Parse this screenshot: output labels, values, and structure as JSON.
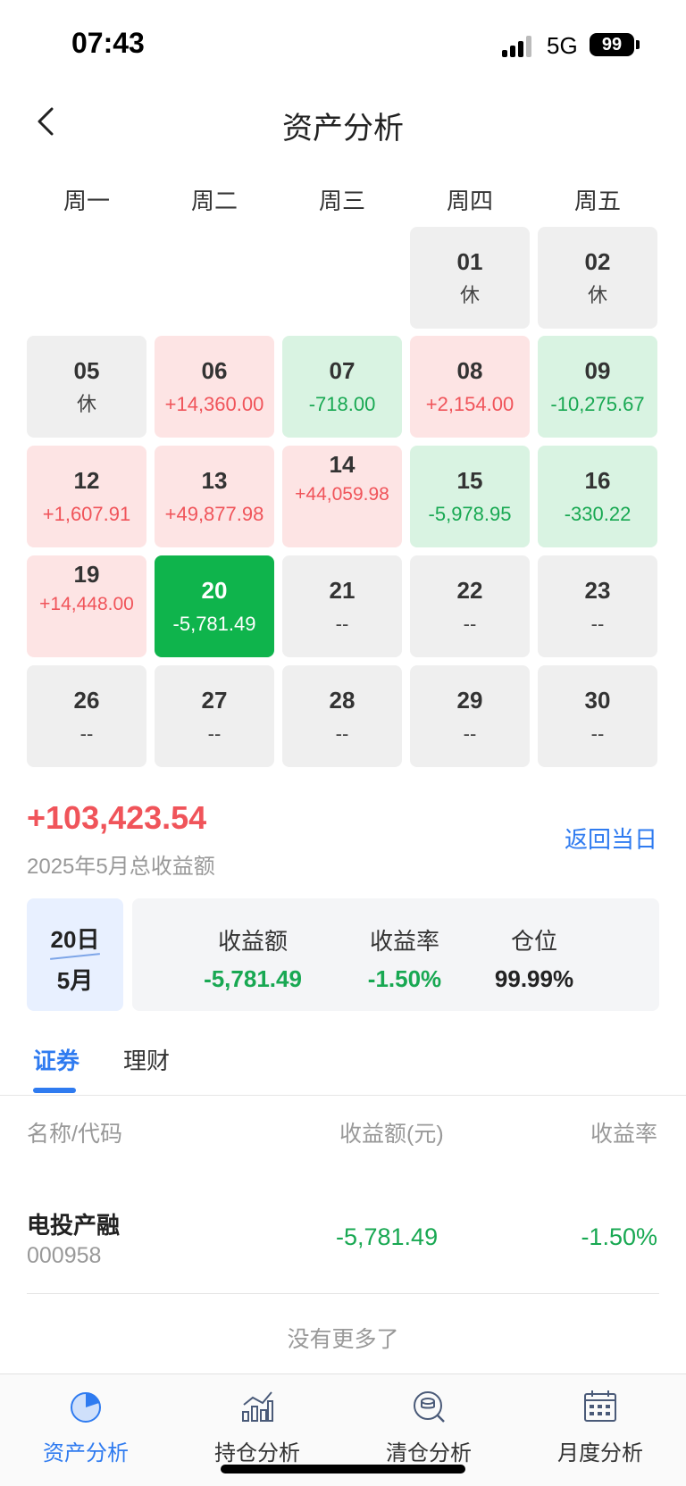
{
  "status_bar": {
    "time": "07:43",
    "network": "5G",
    "battery": "99"
  },
  "header": {
    "title": "资产分析",
    "back_icon": "chevron-left-icon"
  },
  "calendar": {
    "weekdays": [
      "周一",
      "周二",
      "周三",
      "周四",
      "周五"
    ],
    "days": [
      {
        "day": "01",
        "value": "休",
        "state": "rest"
      },
      {
        "day": "02",
        "value": "休",
        "state": "rest"
      },
      {
        "day": "05",
        "value": "休",
        "state": "rest"
      },
      {
        "day": "06",
        "value": "+14,360.00",
        "state": "gain"
      },
      {
        "day": "07",
        "value": "-718.00",
        "state": "loss"
      },
      {
        "day": "08",
        "value": "+2,154.00",
        "state": "gain"
      },
      {
        "day": "09",
        "value": "-10,275.67",
        "state": "loss"
      },
      {
        "day": "12",
        "value": "+1,607.91",
        "state": "gain"
      },
      {
        "day": "13",
        "value": "+49,877.98",
        "state": "gain"
      },
      {
        "day": "14",
        "value": "+44,059.98",
        "state": "gain"
      },
      {
        "day": "15",
        "value": "-5,978.95",
        "state": "loss"
      },
      {
        "day": "16",
        "value": "-330.22",
        "state": "loss"
      },
      {
        "day": "19",
        "value": "+14,448.00",
        "state": "gain"
      },
      {
        "day": "20",
        "value": "-5,781.49",
        "state": "selected"
      },
      {
        "day": "21",
        "value": "--",
        "state": "future"
      },
      {
        "day": "22",
        "value": "--",
        "state": "future"
      },
      {
        "day": "23",
        "value": "--",
        "state": "future"
      },
      {
        "day": "26",
        "value": "--",
        "state": "future"
      },
      {
        "day": "27",
        "value": "--",
        "state": "future"
      },
      {
        "day": "28",
        "value": "--",
        "state": "future"
      },
      {
        "day": "29",
        "value": "--",
        "state": "future"
      },
      {
        "day": "30",
        "value": "--",
        "state": "future"
      }
    ]
  },
  "total": {
    "amount": "+103,423.54",
    "label": "2025年5月总收益额",
    "return_today": "返回当日"
  },
  "summary": {
    "day": "20日",
    "month": "5月",
    "metrics": [
      {
        "label": "收益额",
        "value": "-5,781.49"
      },
      {
        "label": "收益率",
        "value": "-1.50%"
      },
      {
        "label": "仓位",
        "value": "99.99%"
      }
    ]
  },
  "tabs": [
    {
      "label": "证券",
      "active": true
    },
    {
      "label": "理财",
      "active": false
    }
  ],
  "table": {
    "headers": {
      "name": "名称/代码",
      "amount": "收益额(元)",
      "rate": "收益率"
    },
    "rows": [
      {
        "name": "电投产融",
        "code": "000958",
        "amount": "-5,781.49",
        "rate": "-1.50%"
      }
    ],
    "footer": "没有更多了"
  },
  "bottom_nav": [
    {
      "label": "资产分析",
      "icon": "pie-chart-icon",
      "active": true
    },
    {
      "label": "持仓分析",
      "icon": "bar-chart-icon",
      "active": false
    },
    {
      "label": "清仓分析",
      "icon": "coin-search-icon",
      "active": false
    },
    {
      "label": "月度分析",
      "icon": "calendar-icon",
      "active": false
    }
  ],
  "colors": {
    "accent": "#2f7bf0",
    "gain": "#f0545a",
    "loss": "#18a852",
    "selected": "#0fb44c"
  }
}
